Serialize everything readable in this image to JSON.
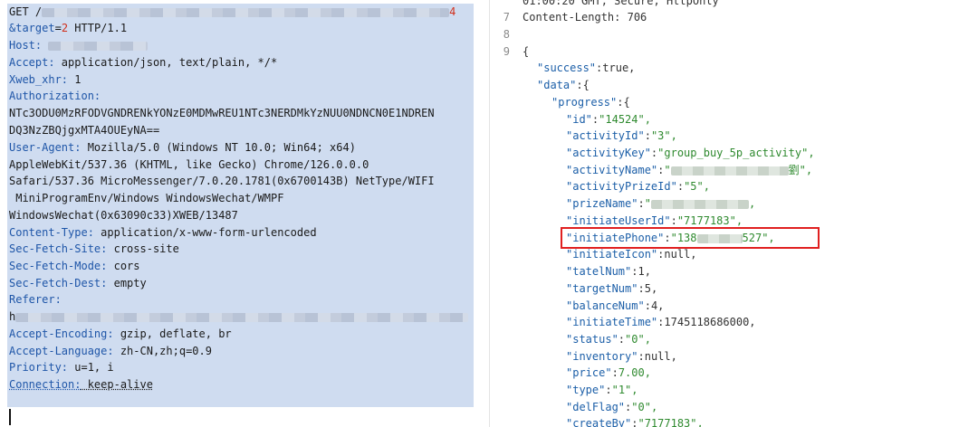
{
  "request": {
    "line_get": "GET /",
    "line_get_end": "4",
    "target_key": "&target",
    "target_eq": "=",
    "target_val": "2",
    "target_rest": " HTTP/1.1",
    "host_key": "Host:",
    "accept_key": "Accept:",
    "accept_val": " application/json, text/plain, */*",
    "xweb_key": "Xweb_xhr:",
    "xweb_val": " 1",
    "auth_key": "Authorization:",
    "auth_val1": "NTc3ODU0MzRFODVGNDRENkYONzE0MDMwREU1NTc3NERDMkYzNUU0NDNCN0E1NDREN",
    "auth_val2": "DQ3NzZBQjgxMTA4OUEyNA==",
    "ua_key": "User-Agent:",
    "ua_val": " Mozilla/5.0 (Windows NT 10.0; Win64; x64)",
    "ua_l2": "AppleWebKit/537.36 (KHTML, like Gecko) Chrome/126.0.0.0",
    "ua_l3": "Safari/537.36 MicroMessenger/7.0.20.1781(0x6700143B) NetType/WIFI",
    "ua_l4": " MiniProgramEnv/Windows WindowsWechat/WMPF",
    "ua_l5": "WindowsWechat(0x63090c33)XWEB/13487",
    "ct_key": "Content-Type:",
    "ct_val": " application/x-www-form-urlencoded",
    "sfs_key": "Sec-Fetch-Site:",
    "sfs_val": " cross-site",
    "sfm_key": "Sec-Fetch-Mode:",
    "sfm_val": " cors",
    "sfd_key": "Sec-Fetch-Dest:",
    "sfd_val": " empty",
    "ref_key": "Referer:",
    "ref_val": "h",
    "ae_key": "Accept-Encoding:",
    "ae_val": " gzip, deflate, br",
    "al_key": "Accept-Language:",
    "al_val": " zh-CN,zh;q=0.9",
    "pr_key": "Priority:",
    "pr_val": " u=1, i",
    "conn_key": "Connection:",
    "conn_val": " keep-alive"
  },
  "response": {
    "top_fragment": "01:00:20 GMT; Secure; HttpOnly",
    "ln7": "7",
    "content_length_key": "Content-Length:",
    "content_length_val": " 706",
    "ln8": "8",
    "ln9": "9",
    "brace_open": "{",
    "success_key": "\"success\"",
    "success_val": "true,",
    "data_key": "\"data\"",
    "data_open": ":{",
    "progress_key": "\"progress\"",
    "progress_open": ":{",
    "id_key": "\"id\"",
    "id_val": "\"14524\",",
    "activityId_key": "\"activityId\"",
    "activityId_val": "\"3\",",
    "activityKey_key": "\"activityKey\"",
    "activityKey_val": "\"group_buy_5p_activity\",",
    "activityName_key": "\"activityName\"",
    "activityName_val_pre": "\"",
    "activityName_val_post": "劉\",",
    "activityPrizeId_key": "\"activityPrizeId\"",
    "activityPrizeId_val": "\"5\",",
    "prizeName_key": "\"prizeName\"",
    "prizeName_val_pre": "\"",
    "prizeName_val_post": ",",
    "initiateUserId_key": "\"initiateUserId\"",
    "initiateUserId_val": "\"7177183\",",
    "initiatePhone_key": "\"initiatePhone\"",
    "initiatePhone_val_pre": "\"138",
    "initiatePhone_val_post": "527\",",
    "initiateIcon_key": "\"initiateIcon\"",
    "initiateIcon_val": "null,",
    "tatelNum_key": "\"tatelNum\"",
    "tatelNum_val": "1,",
    "targetNum_key": "\"targetNum\"",
    "targetNum_val": "5,",
    "balanceNum_key": "\"balanceNum\"",
    "balanceNum_val": "4,",
    "initiateTime_key": "\"initiateTime\"",
    "initiateTime_val": "1745118686000,",
    "status_key": "\"status\"",
    "status_val": "\"0\",",
    "inventory_key": "\"inventory\"",
    "inventory_val": "null,",
    "price_key": "\"price\"",
    "price_val": "7.00,",
    "type_key": "\"type\"",
    "type_val": "\"1\",",
    "delFlag_key": "\"delFlag\"",
    "delFlag_val": "\"0\",",
    "createBy_key": "\"createBy\"",
    "createBy_val": "\"7177183\","
  },
  "colors": {
    "selection": "#cfdcf0",
    "key": "#1c5fa8",
    "string": "#2f8a2f",
    "highlight_box": "#e02020"
  }
}
